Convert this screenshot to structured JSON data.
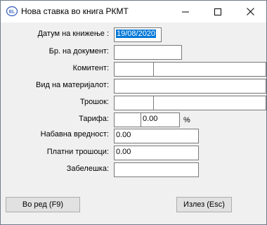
{
  "window": {
    "title": "Нова ставка во книга РКМТ",
    "icon": "app-icon"
  },
  "titlebar_buttons": {
    "minimize": "minimize-icon",
    "maximize": "maximize-icon",
    "close": "close-icon"
  },
  "form": {
    "posting_date": {
      "label": "Датум на книжење :",
      "value": "19/08/2020"
    },
    "document_no": {
      "label": "Бр. на документ:",
      "value": ""
    },
    "partner": {
      "label": "Комитент:",
      "code": "",
      "name": ""
    },
    "material_type": {
      "label": "Вид на материјалот:",
      "value": ""
    },
    "cost": {
      "label": "Трошок:",
      "code": "",
      "name": ""
    },
    "tariff": {
      "label": "Тарифа:",
      "code": "",
      "percent": "0.00",
      "unit": "%"
    },
    "purchase_value": {
      "label": "Набавна вредност:",
      "value": "0.00"
    },
    "paid_costs": {
      "label": "Платни трошоци:",
      "value": "0.00"
    },
    "note": {
      "label": "Забелешка:",
      "value": ""
    }
  },
  "buttons": {
    "ok": "Во ред (F9)",
    "exit": "Излез (Esc)"
  }
}
